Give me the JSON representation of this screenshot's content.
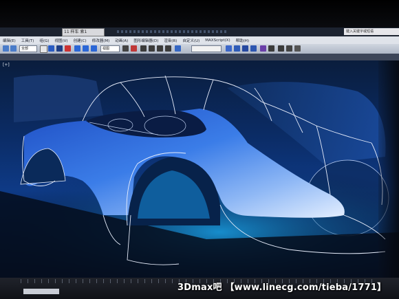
{
  "window": {
    "document_tab": "11 样车 索1",
    "help_search": "键入关键字或短语"
  },
  "menu": {
    "items": [
      "编辑(E)",
      "工具(T)",
      "组(G)",
      "视图(V)",
      "创建(C)",
      "修改器(M)",
      "动画(A)",
      "图形编辑器(D)",
      "渲染(R)",
      "自定义(U)",
      "MAXScript(X)",
      "帮助(H)"
    ]
  },
  "toolbar": {
    "selection_filter": "全部",
    "view_dropdown": "视图"
  },
  "viewport": {
    "label": "[+]"
  },
  "watermark": {
    "text": "3Dmax吧 【www.linecg.com/tieba/1771】"
  },
  "colors": {
    "viewport_blue": "#0e3a86",
    "car_body_blue": "#2f6fe0",
    "wireframe": "#e8eefc",
    "menu_bg": "#dfe3ea"
  }
}
